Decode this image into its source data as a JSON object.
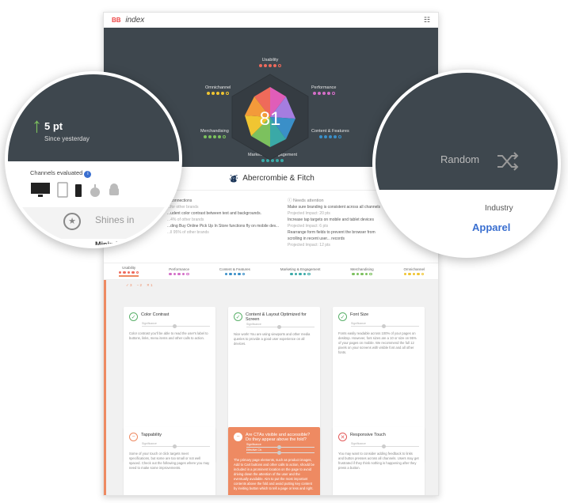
{
  "app": {
    "logo": "BB",
    "title": "index"
  },
  "hero": {
    "score": "81",
    "categories": [
      {
        "label": "Usability",
        "colors": [
          "#ee6a5c",
          "#ee6a5c",
          "#ee6a5c",
          "#ee6a5c",
          "#fff"
        ]
      },
      {
        "label": "Performance",
        "colors": [
          "#d36ec7",
          "#d36ec7",
          "#d36ec7",
          "#d36ec7",
          "#fff"
        ]
      },
      {
        "label": "Content & Features",
        "colors": [
          "#3a8fc8",
          "#3a8fc8",
          "#3a8fc8",
          "#3a8fc8",
          "#fff"
        ]
      },
      {
        "label": "Marketing & Engagement",
        "colors": [
          "#3aa9a7",
          "#3aa9a7",
          "#3aa9a7",
          "#3aa9a7",
          "#3aa9a7"
        ]
      },
      {
        "label": "Merchandising",
        "colors": [
          "#7cc15e",
          "#7cc15e",
          "#7cc15e",
          "#7cc15e",
          "#fff"
        ]
      },
      {
        "label": "Omnichannel",
        "colors": [
          "#f0c532",
          "#f0c532",
          "#f0c532",
          "#f0c532",
          "#fff"
        ]
      }
    ]
  },
  "brand": {
    "name": "Abercrombie & Fitch"
  },
  "info": {
    "left_lines": [
      "P connections",
      "...for other brands",
      "...udent color contrast between text and backgrounds.",
      "...4% of other brands",
      "...ding Buy Online Pick Up In Store functions fly on mobile dev...",
      "...ll 95% of other brands"
    ],
    "needs_attention": "Needs attention",
    "right_lines": [
      "Make sure branding is consistent across all channels",
      "Projected Impact: 20 pts",
      "Increase tap targets on mobile and tablet devices",
      "Projected Impact: 6 pts",
      "Rearrange form fields to prevent the browser from scrolling in recent user... records",
      "Projected Impact: 12 pts"
    ]
  },
  "tabs": [
    {
      "label": "Usability",
      "color": "#ee6a5c"
    },
    {
      "label": "Performance",
      "color": "#d36ec7"
    },
    {
      "label": "Content & Features",
      "color": "#3a8fc8"
    },
    {
      "label": "Marketing & Engagement",
      "color": "#3aa9a7"
    },
    {
      "label": "Merchandising",
      "color": "#7cc15e"
    },
    {
      "label": "Omnichannel",
      "color": "#f0c532"
    }
  ],
  "filters": [
    "3",
    "2",
    "1"
  ],
  "cards": [
    {
      "title": "Color Contrast",
      "status": "ok",
      "slider_label": "Significance",
      "body": "Color contrast you'll be able to read the user's label to buttons, links, menu items and other calls to action.",
      "more": ""
    },
    {
      "title": "Content & Layout Optimized for Screen",
      "status": "ok",
      "slider_label": "Significance",
      "body": "Nice work! You are using viewports and other media queries to provide a good user experience on all devices.",
      "more": "Help me find out"
    },
    {
      "title": "Font Size",
      "status": "ok",
      "slider_label": "Significance",
      "body": "Fonts easily readable across 100% of your pages on desktop. However, font sizes are a 10 or size on 95% of your pages on mobile. We recommend the full 12 pixels on your screens with visible font and all other fonts.",
      "more": ""
    },
    {
      "title": "Tappability",
      "status": "warn",
      "slider_label": "Significance",
      "body": "Some of your touch or click targets meet specifications, but some are too small or not well spaced. Check out the following pages where you may need to make some improvements.",
      "more": ""
    },
    {
      "title": "Are CTAs visible and accessible? Do they appear above the fold?",
      "status": "warn",
      "slider_label": "Significance",
      "slider_label2": "Effective Ctr.",
      "body": "The primary page elements, such as product images, Add to Cart buttons and other calls to action, should be included in a prominent location on the page to avoid driving down the attention of the user and the eventually available. Aim to put the most important contents above the fold and avoid putting key content by inviting button which to tell a page or less and right.",
      "more": ""
    },
    {
      "title": "Responsive Touch",
      "status": "bad",
      "slider_label": "Significance",
      "body": "You may want to consider adding feedback to links and button presses across all channels. Users may get frustrated if they think nothing is happening after they press a button.",
      "more": ""
    }
  ],
  "magnifier_left": {
    "delta": "5 pt",
    "delta_sub": "Since yesterday",
    "channels_label": "Channels evaluated",
    "channels": [
      "desktop-icon",
      "tablet-icon",
      "mobile-icon",
      "apple-icon",
      "android-icon"
    ],
    "shines_label": "Shines in",
    "minimizing": "Minimizing"
  },
  "magnifier_right": {
    "random": "Random",
    "industry_label": "Industry",
    "industry_value": "Apparel"
  }
}
